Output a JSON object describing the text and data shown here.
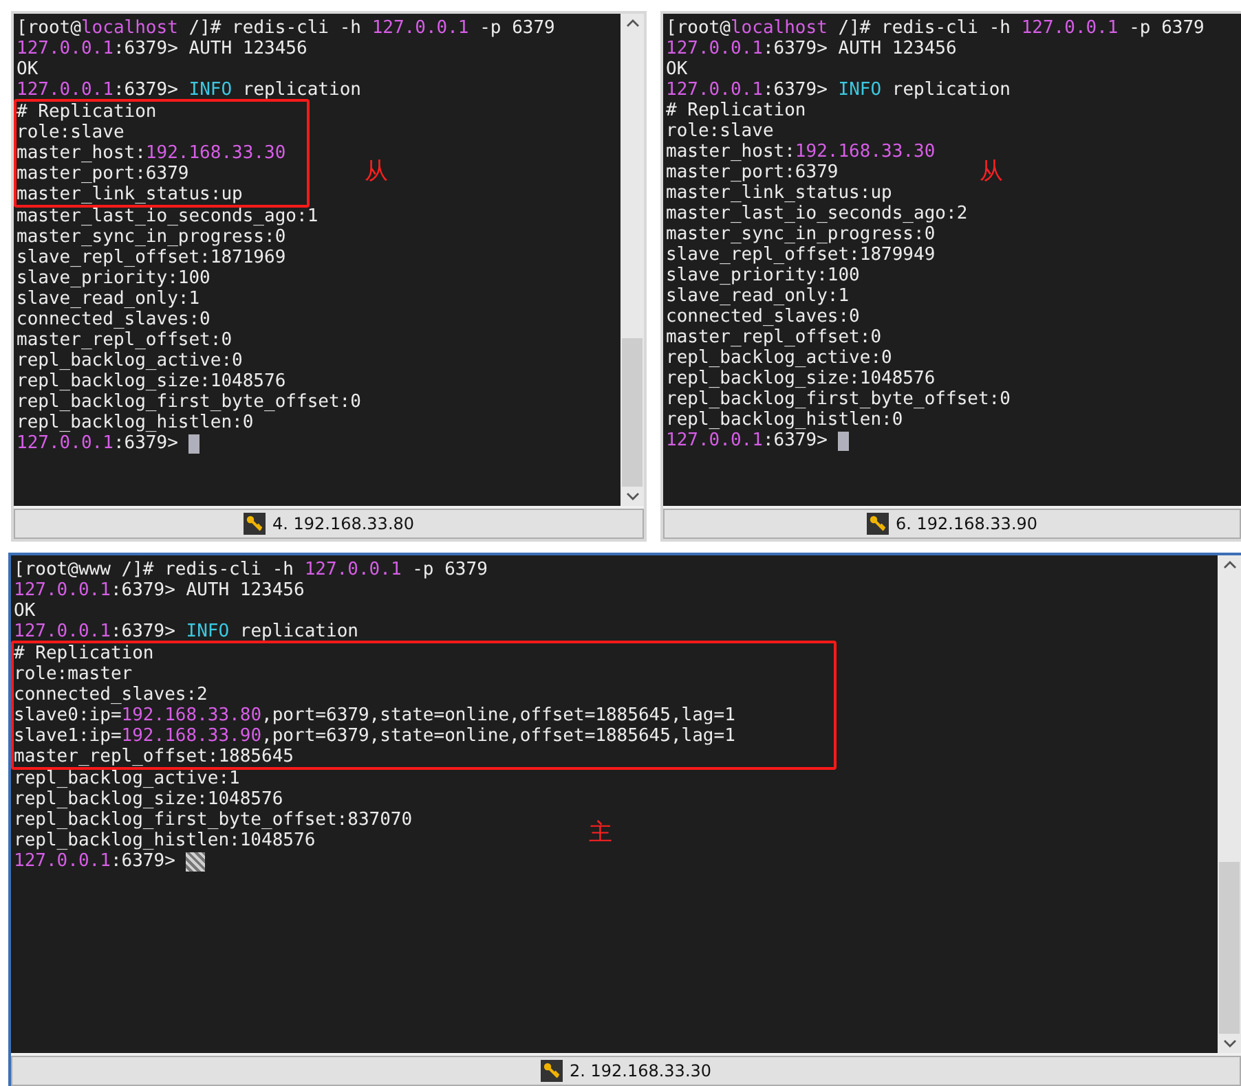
{
  "panes": [
    {
      "active": false,
      "scrollbar": true,
      "tab": "4. 192.168.33.80",
      "note": "从",
      "lines": [
        {
          "boxed": false,
          "segments": [
            {
              "text": "[root@",
              "kind": "plain"
            },
            {
              "text": "localhost",
              "kind": "host"
            },
            {
              "text": " /]# redis-cli -h ",
              "kind": "plain"
            },
            {
              "text": "127.0.0.1",
              "kind": "host"
            },
            {
              "text": " -p 6379",
              "kind": "plain"
            }
          ]
        },
        {
          "boxed": false,
          "segments": [
            {
              "text": "127.0.0.1",
              "kind": "host"
            },
            {
              "text": ":6379> AUTH 123456",
              "kind": "plain"
            }
          ]
        },
        {
          "boxed": false,
          "segments": [
            {
              "text": "OK",
              "kind": "plain"
            }
          ]
        },
        {
          "boxed": false,
          "segments": [
            {
              "text": "127.0.0.1",
              "kind": "host"
            },
            {
              "text": ":6379> ",
              "kind": "plain"
            },
            {
              "text": "INFO",
              "kind": "keyword"
            },
            {
              "text": " replication",
              "kind": "plain"
            }
          ]
        },
        {
          "boxed": true,
          "segments": [
            {
              "text": "# Replication",
              "kind": "plain"
            }
          ]
        },
        {
          "boxed": true,
          "segments": [
            {
              "text": "role:slave",
              "kind": "plain"
            }
          ]
        },
        {
          "boxed": true,
          "segments": [
            {
              "text": "master_host:",
              "kind": "plain"
            },
            {
              "text": "192.168.33.30",
              "kind": "host"
            }
          ]
        },
        {
          "boxed": true,
          "segments": [
            {
              "text": "master_port:6379",
              "kind": "plain"
            }
          ]
        },
        {
          "boxed": true,
          "segments": [
            {
              "text": "master_link_status:up",
              "kind": "plain"
            }
          ]
        },
        {
          "boxed": false,
          "segments": [
            {
              "text": "master_last_io_seconds_ago:1",
              "kind": "plain"
            }
          ]
        },
        {
          "boxed": false,
          "segments": [
            {
              "text": "master_sync_in_progress:0",
              "kind": "plain"
            }
          ]
        },
        {
          "boxed": false,
          "segments": [
            {
              "text": "slave_repl_offset:1871969",
              "kind": "plain"
            }
          ]
        },
        {
          "boxed": false,
          "segments": [
            {
              "text": "slave_priority:100",
              "kind": "plain"
            }
          ]
        },
        {
          "boxed": false,
          "segments": [
            {
              "text": "slave_read_only:1",
              "kind": "plain"
            }
          ]
        },
        {
          "boxed": false,
          "segments": [
            {
              "text": "connected_slaves:0",
              "kind": "plain"
            }
          ]
        },
        {
          "boxed": false,
          "segments": [
            {
              "text": "master_repl_offset:0",
              "kind": "plain"
            }
          ]
        },
        {
          "boxed": false,
          "segments": [
            {
              "text": "repl_backlog_active:0",
              "kind": "plain"
            }
          ]
        },
        {
          "boxed": false,
          "segments": [
            {
              "text": "repl_backlog_size:1048576",
              "kind": "plain"
            }
          ]
        },
        {
          "boxed": false,
          "segments": [
            {
              "text": "repl_backlog_first_byte_offset:0",
              "kind": "plain"
            }
          ]
        },
        {
          "boxed": false,
          "segments": [
            {
              "text": "repl_backlog_histlen:0",
              "kind": "plain"
            }
          ]
        },
        {
          "boxed": false,
          "cursor": true,
          "segments": [
            {
              "text": "127.0.0.1",
              "kind": "host"
            },
            {
              "text": ":6379>",
              "kind": "plain"
            }
          ]
        }
      ]
    },
    {
      "active": false,
      "tab": "6. 192.168.33.90",
      "note": "从",
      "lines": [
        {
          "boxed": false,
          "segments": [
            {
              "text": "[root@",
              "kind": "plain"
            },
            {
              "text": "localhost",
              "kind": "host"
            },
            {
              "text": " /]# redis-cli -h ",
              "kind": "plain"
            },
            {
              "text": "127.0.0.1",
              "kind": "host"
            },
            {
              "text": " -p 6379",
              "kind": "plain"
            }
          ]
        },
        {
          "boxed": false,
          "segments": [
            {
              "text": "127.0.0.1",
              "kind": "host"
            },
            {
              "text": ":6379> AUTH 123456",
              "kind": "plain"
            }
          ]
        },
        {
          "boxed": false,
          "segments": [
            {
              "text": "OK",
              "kind": "plain"
            }
          ]
        },
        {
          "boxed": false,
          "segments": [
            {
              "text": "127.0.0.1",
              "kind": "host"
            },
            {
              "text": ":6379> ",
              "kind": "plain"
            },
            {
              "text": "INFO",
              "kind": "keyword"
            },
            {
              "text": " replication",
              "kind": "plain"
            }
          ]
        },
        {
          "boxed": false,
          "segments": [
            {
              "text": "# Replication",
              "kind": "plain"
            }
          ]
        },
        {
          "boxed": false,
          "segments": [
            {
              "text": "role:slave",
              "kind": "plain"
            }
          ]
        },
        {
          "boxed": false,
          "segments": [
            {
              "text": "master_host:",
              "kind": "plain"
            },
            {
              "text": "192.168.33.30",
              "kind": "host"
            }
          ]
        },
        {
          "boxed": false,
          "segments": [
            {
              "text": "master_port:6379",
              "kind": "plain"
            }
          ]
        },
        {
          "boxed": false,
          "segments": [
            {
              "text": "master_link_status:up",
              "kind": "plain"
            }
          ]
        },
        {
          "boxed": false,
          "segments": [
            {
              "text": "master_last_io_seconds_ago:2",
              "kind": "plain"
            }
          ]
        },
        {
          "boxed": false,
          "segments": [
            {
              "text": "master_sync_in_progress:0",
              "kind": "plain"
            }
          ]
        },
        {
          "boxed": false,
          "segments": [
            {
              "text": "slave_repl_offset:1879949",
              "kind": "plain"
            }
          ]
        },
        {
          "boxed": false,
          "segments": [
            {
              "text": "slave_priority:100",
              "kind": "plain"
            }
          ]
        },
        {
          "boxed": false,
          "segments": [
            {
              "text": "slave_read_only:1",
              "kind": "plain"
            }
          ]
        },
        {
          "boxed": false,
          "segments": [
            {
              "text": "connected_slaves:0",
              "kind": "plain"
            }
          ]
        },
        {
          "boxed": false,
          "segments": [
            {
              "text": "master_repl_offset:0",
              "kind": "plain"
            }
          ]
        },
        {
          "boxed": false,
          "segments": [
            {
              "text": "repl_backlog_active:0",
              "kind": "plain"
            }
          ]
        },
        {
          "boxed": false,
          "segments": [
            {
              "text": "repl_backlog_size:1048576",
              "kind": "plain"
            }
          ]
        },
        {
          "boxed": false,
          "segments": [
            {
              "text": "repl_backlog_first_byte_offset:0",
              "kind": "plain"
            }
          ]
        },
        {
          "boxed": false,
          "segments": [
            {
              "text": "repl_backlog_histlen:0",
              "kind": "plain"
            }
          ]
        },
        {
          "boxed": false,
          "cursor": true,
          "segments": [
            {
              "text": "127.0.0.1",
              "kind": "host"
            },
            {
              "text": ":6379>",
              "kind": "plain"
            }
          ]
        }
      ]
    },
    {
      "active": true,
      "scrollbar": true,
      "tab": "2. 192.168.33.30",
      "note": "主",
      "lines": [
        {
          "boxed": false,
          "segments": [
            {
              "text": "[root@www /]# redis-cli -h ",
              "kind": "plain"
            },
            {
              "text": "127.0.0.1",
              "kind": "host"
            },
            {
              "text": " -p 6379",
              "kind": "plain"
            }
          ]
        },
        {
          "boxed": false,
          "segments": [
            {
              "text": "127.0.0.1",
              "kind": "host"
            },
            {
              "text": ":6379> AUTH 123456",
              "kind": "plain"
            }
          ]
        },
        {
          "boxed": false,
          "segments": [
            {
              "text": "OK",
              "kind": "plain"
            }
          ]
        },
        {
          "boxed": false,
          "segments": [
            {
              "text": "127.0.0.1",
              "kind": "host"
            },
            {
              "text": ":6379> ",
              "kind": "plain"
            },
            {
              "text": "INFO",
              "kind": "keyword"
            },
            {
              "text": " replication",
              "kind": "plain"
            }
          ]
        },
        {
          "boxed": true,
          "segments": [
            {
              "text": "# Replication",
              "kind": "plain"
            }
          ]
        },
        {
          "boxed": true,
          "segments": [
            {
              "text": "role:master",
              "kind": "plain"
            }
          ]
        },
        {
          "boxed": true,
          "segments": [
            {
              "text": "connected_slaves:2",
              "kind": "plain"
            }
          ]
        },
        {
          "boxed": true,
          "segments": [
            {
              "text": "slave0:ip=",
              "kind": "plain"
            },
            {
              "text": "192.168.33.80",
              "kind": "host"
            },
            {
              "text": ",port=6379,state=online,offset=1885645,lag=1",
              "kind": "plain"
            }
          ]
        },
        {
          "boxed": true,
          "segments": [
            {
              "text": "slave1:ip=",
              "kind": "plain"
            },
            {
              "text": "192.168.33.90",
              "kind": "host"
            },
            {
              "text": ",port=6379,state=online,offset=1885645,lag=1",
              "kind": "plain"
            }
          ]
        },
        {
          "boxed": true,
          "segments": [
            {
              "text": "master_repl_offset:1885645",
              "kind": "plain"
            }
          ]
        },
        {
          "boxed": false,
          "segments": [
            {
              "text": "repl_backlog_active:1",
              "kind": "plain"
            }
          ]
        },
        {
          "boxed": false,
          "segments": [
            {
              "text": "repl_backlog_size:1048576",
              "kind": "plain"
            }
          ]
        },
        {
          "boxed": false,
          "segments": [
            {
              "text": "repl_backlog_first_byte_offset:837070",
              "kind": "plain"
            }
          ]
        },
        {
          "boxed": false,
          "segments": [
            {
              "text": "repl_backlog_histlen:1048576",
              "kind": "plain"
            }
          ]
        },
        {
          "boxed": false,
          "cursor": true,
          "segments": [
            {
              "text": "127.0.0.1",
              "kind": "host"
            },
            {
              "text": ":6379>",
              "kind": "plain"
            }
          ]
        }
      ]
    }
  ]
}
